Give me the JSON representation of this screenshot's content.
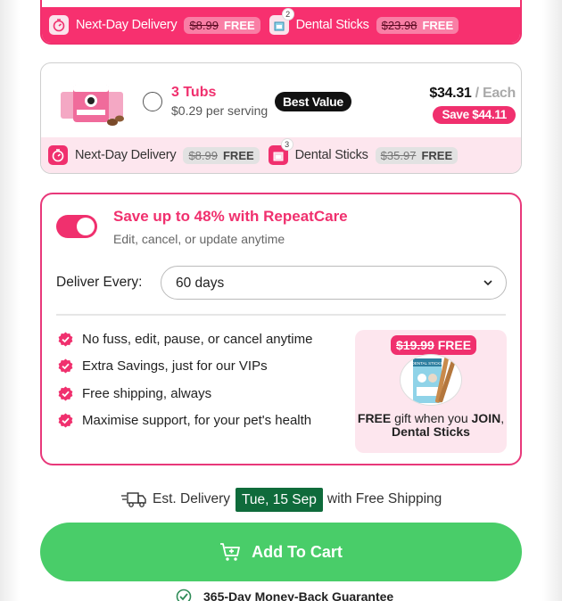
{
  "colors": {
    "accent_pink": "#f0306e",
    "light_pink": "#fde6ee",
    "dark_green": "#0f6b3b",
    "cart_green": "#49cd69"
  },
  "top_card": {
    "perks": [
      {
        "icon": "stopwatch-icon",
        "label": "Next-Day Delivery",
        "old_price": "$8.99",
        "free": "FREE"
      },
      {
        "icon": "gift-box-icon",
        "badge": "2",
        "label": "Dental Sticks",
        "old_price": "$23.98",
        "free": "FREE"
      }
    ]
  },
  "tubs_card": {
    "title": "3 Tubs",
    "serving": "$0.29 per serving",
    "badge": "Best Value",
    "price": "$34.31",
    "price_suffix": " / Each",
    "save": "Save $44.11",
    "perks": [
      {
        "icon": "stopwatch-icon",
        "label": "Next-Day Delivery",
        "old_price": "$8.99",
        "free": "FREE"
      },
      {
        "icon": "gift-box-icon",
        "badge": "3",
        "label": "Dental Sticks",
        "old_price": "$35.97",
        "free": "FREE"
      }
    ]
  },
  "repeatcare": {
    "toggle_on": true,
    "title": "Save up to 48% with RepeatCare",
    "subtitle": "Edit, cancel, or update anytime",
    "deliver_label": "Deliver Every:",
    "deliver_value": "60 days",
    "benefits": [
      "No fuss, edit, pause, or cancel anytime",
      "Extra Savings, just for our VIPs",
      "Free shipping, always",
      "Maximise support, for your pet's health"
    ],
    "gift": {
      "old_price": "$19.99",
      "free": "FREE",
      "caption_free": "FREE",
      "caption_mid": " gift when you ",
      "caption_join": "JOIN",
      "caption_comma": ",",
      "caption_item": "Dental Sticks",
      "product_label": "DENTAL STICKS"
    }
  },
  "delivery": {
    "prefix": "Est. Delivery",
    "date": "Tue, 15 Sep",
    "suffix": "with Free Shipping"
  },
  "cart": {
    "label": "Add To Cart"
  },
  "guarantee": {
    "label": "365-Day Money-Back Guarantee"
  }
}
